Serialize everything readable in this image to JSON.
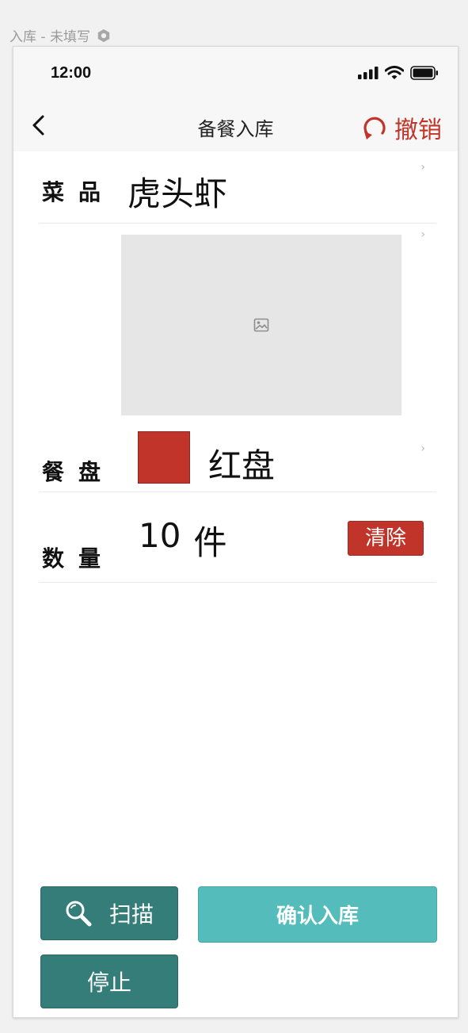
{
  "canvas": {
    "label": "入库 - 未填写"
  },
  "status_bar": {
    "time": "12:00",
    "icons": [
      "cellular-signal-icon",
      "wifi-icon",
      "battery-icon"
    ]
  },
  "nav": {
    "back_icon": "chevron-left-icon",
    "title": "备餐入库",
    "undo_label": "撤销",
    "undo_icon": "refresh-icon",
    "accent_color": "#c0342a"
  },
  "form": {
    "dish": {
      "label": "菜品",
      "value": "虎头虾"
    },
    "photo": {
      "icon": "image-placeholder-icon"
    },
    "plate": {
      "label": "餐盘",
      "color": "#c1342a",
      "name": "红盘"
    },
    "quantity": {
      "label": "数量",
      "value": "10",
      "unit": "件",
      "clear_label": "清除"
    }
  },
  "actions": {
    "scan_label": "扫描",
    "scan_icon": "search-icon",
    "confirm_label": "确认入库",
    "stop_label": "停止",
    "primary_color": "#357d79",
    "confirm_color": "#54bdbc"
  }
}
